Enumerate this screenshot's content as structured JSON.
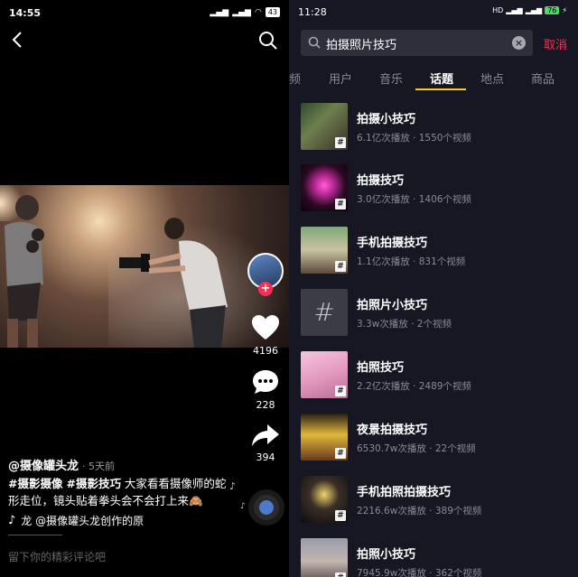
{
  "left": {
    "status": {
      "time": "14:55",
      "signal": "..lll",
      "wifi": "wifi",
      "battery": "43"
    },
    "icons": {
      "back": "back-arrow-icon",
      "search": "search-icon"
    },
    "author": {
      "name": "@摄像罐头龙",
      "ago": "· 5天前"
    },
    "caption": {
      "tag1": "#摄影摄像",
      "tag2": "#摄影技巧",
      "text": " 大家看看摄像师的蛇形走位，镜头贴着拳头会不会打上来"
    },
    "music": {
      "icon": "tiktok-note-icon",
      "text": "龙   @摄像罐头龙创作的原"
    },
    "side": {
      "likes": "4196",
      "comments": "228",
      "shares": "394"
    },
    "comment_placeholder": "留下你的精彩评论吧"
  },
  "right": {
    "status": {
      "time": "11:28",
      "battery": "76"
    },
    "search": {
      "query": "拍摄照片技巧",
      "cancel": "取消"
    },
    "tabs": [
      {
        "label": "频"
      },
      {
        "label": "用户"
      },
      {
        "label": "音乐"
      },
      {
        "label": "话题"
      },
      {
        "label": "地点"
      },
      {
        "label": "商品"
      }
    ],
    "active_tab": "话题",
    "accent_color": "#face15",
    "cancel_color": "#fe2c55",
    "results": [
      {
        "title": "拍摄小技巧",
        "meta": "6.1亿次播放 · 1550个视频"
      },
      {
        "title": "拍摄技巧",
        "meta": "3.0亿次播放 · 1406个视频"
      },
      {
        "title": "手机拍摄技巧",
        "meta": "1.1亿次播放 · 831个视频"
      },
      {
        "title": "拍照片小技巧",
        "meta": "3.3w次播放 · 2个视频"
      },
      {
        "title": "拍照技巧",
        "meta": "2.2亿次播放 · 2489个视频"
      },
      {
        "title": "夜景拍摄技巧",
        "meta": "6530.7w次播放 · 22个视频"
      },
      {
        "title": "手机拍照拍摄技巧",
        "meta": "2216.6w次播放 · 389个视频"
      },
      {
        "title": "拍照小技巧",
        "meta": "7945.9w次播放 · 362个视频"
      }
    ]
  }
}
